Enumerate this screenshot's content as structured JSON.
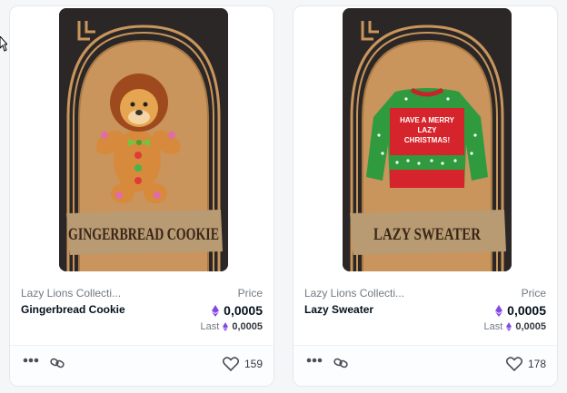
{
  "cards": [
    {
      "art_title": "GINGERBREAD COOKIE",
      "art_subject": "gingerbread-lion",
      "collection": "Lazy Lions Collecti...",
      "name": "Gingerbread Cookie",
      "price_label": "Price",
      "price": "0,0005",
      "last_label": "Last",
      "last_price": "0,0005",
      "likes": "159"
    },
    {
      "art_title": "LAZY SWEATER",
      "art_subject": "christmas-sweater",
      "sweater_text": [
        "HAVE A MERRY",
        "LAZY",
        "CHRISTMAS!"
      ],
      "collection": "Lazy Lions Collecti...",
      "name": "Lazy Sweater",
      "price_label": "Price",
      "price": "0,0005",
      "last_label": "Last",
      "last_price": "0,0005",
      "likes": "178"
    }
  ],
  "colors": {
    "eth_purple": "#8247e5",
    "card_bg": "#2a2726",
    "arch_tan": "#c9955c",
    "banner": "#b89a73"
  }
}
